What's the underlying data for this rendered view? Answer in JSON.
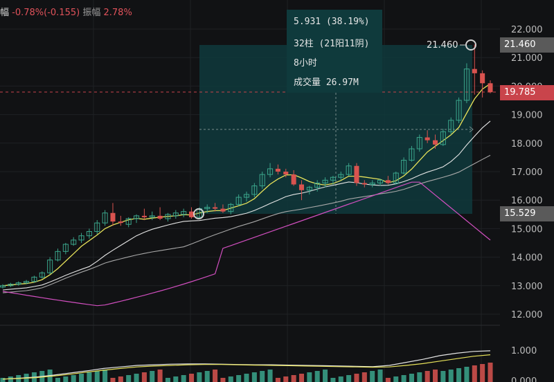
{
  "header": {
    "label_fragment": "幅",
    "change": "-0.78%(-0.155)",
    "amplitude_label": "振幅",
    "amplitude_value": "2.78%"
  },
  "info_box": {
    "change_line": "5.931 (38.19%)",
    "bars_line": "32柱 (21阳11阴)",
    "duration_line": "8小时",
    "volume_line": "成交量 26.97M"
  },
  "price_tags": {
    "high": "21.460",
    "current": "19.785",
    "low": "15.529"
  },
  "annotations": {
    "high_label": "21.460"
  },
  "colors": {
    "background": "#111214",
    "up": "#3ba68c",
    "down": "#d9534f",
    "ma_short": "#e8e35a",
    "ma_mid": "#e6e6e6",
    "ma_long": "#a9a9a9",
    "ma_purple": "#d24fc0",
    "measure_box": "#0f3a3c",
    "current_tag": "#c9444b",
    "high_tag": "#5a5a5a",
    "low_tag": "#5a5a5a"
  },
  "chart_data": [
    {
      "type": "candlestick",
      "y_ticks": [
        "22.000",
        "21.000",
        "20.000",
        "19.000",
        "18.000",
        "17.000",
        "16.000",
        "15.000",
        "14.000",
        "13.000",
        "12.000"
      ],
      "ylim": [
        11.5,
        22.3
      ],
      "candles": [
        [
          12.95,
          13.05,
          12.9,
          13.0
        ],
        [
          13.0,
          13.1,
          12.95,
          13.05
        ],
        [
          13.05,
          13.15,
          13.0,
          13.1
        ],
        [
          13.1,
          13.2,
          13.05,
          13.15
        ],
        [
          13.15,
          13.35,
          13.1,
          13.3
        ],
        [
          13.3,
          13.5,
          13.25,
          13.45
        ],
        [
          13.45,
          14.0,
          13.4,
          13.9
        ],
        [
          13.9,
          14.3,
          13.85,
          14.2
        ],
        [
          14.2,
          14.5,
          14.1,
          14.45
        ],
        [
          14.45,
          14.7,
          14.4,
          14.6
        ],
        [
          14.6,
          14.85,
          14.5,
          14.75
        ],
        [
          14.75,
          15.0,
          14.65,
          14.9
        ],
        [
          14.9,
          15.3,
          14.8,
          15.2
        ],
        [
          15.2,
          15.65,
          15.1,
          15.55
        ],
        [
          15.55,
          15.9,
          15.1,
          15.25
        ],
        [
          15.25,
          15.45,
          15.1,
          15.2
        ],
        [
          15.15,
          15.4,
          15.05,
          15.35
        ],
        [
          15.35,
          15.5,
          15.2,
          15.45
        ],
        [
          15.45,
          15.7,
          15.3,
          15.4
        ],
        [
          15.4,
          15.6,
          15.3,
          15.45
        ],
        [
          15.45,
          15.75,
          15.3,
          15.35
        ],
        [
          15.35,
          15.55,
          15.25,
          15.5
        ],
        [
          15.45,
          15.65,
          15.35,
          15.55
        ],
        [
          15.5,
          15.7,
          15.4,
          15.6
        ],
        [
          15.6,
          15.75,
          15.35,
          15.4
        ],
        [
          15.4,
          15.75,
          15.35,
          15.7
        ],
        [
          15.7,
          15.85,
          15.55,
          15.75
        ],
        [
          15.75,
          15.9,
          15.6,
          15.7
        ],
        [
          15.7,
          15.85,
          15.55,
          15.6
        ],
        [
          15.6,
          15.9,
          15.5,
          15.85
        ],
        [
          15.85,
          16.2,
          15.8,
          16.1
        ],
        [
          16.1,
          16.3,
          15.95,
          16.2
        ],
        [
          16.2,
          16.6,
          16.1,
          16.5
        ],
        [
          16.5,
          17.0,
          16.4,
          16.9
        ],
        [
          16.9,
          17.3,
          16.8,
          17.1
        ],
        [
          17.1,
          17.25,
          16.9,
          17.0
        ],
        [
          17.0,
          17.1,
          16.8,
          16.9
        ],
        [
          16.9,
          17.05,
          16.5,
          16.55
        ],
        [
          16.55,
          16.7,
          16.0,
          16.35
        ],
        [
          16.35,
          16.5,
          16.2,
          16.45
        ],
        [
          16.45,
          16.7,
          16.3,
          16.6
        ],
        [
          16.6,
          16.8,
          16.45,
          16.7
        ],
        [
          16.7,
          16.85,
          16.55,
          16.8
        ],
        [
          16.8,
          17.0,
          16.7,
          16.9
        ],
        [
          16.9,
          17.3,
          16.85,
          17.2
        ],
        [
          17.2,
          17.3,
          16.5,
          16.6
        ],
        [
          16.6,
          16.7,
          16.45,
          16.55
        ],
        [
          16.55,
          16.7,
          16.45,
          16.6
        ],
        [
          16.6,
          16.75,
          16.5,
          16.7
        ],
        [
          16.7,
          16.85,
          16.55,
          16.6
        ],
        [
          16.6,
          17.0,
          16.55,
          16.95
        ],
        [
          16.95,
          17.5,
          16.9,
          17.4
        ],
        [
          17.4,
          17.9,
          17.35,
          17.8
        ],
        [
          17.8,
          18.3,
          17.7,
          18.2
        ],
        [
          18.2,
          18.45,
          18.0,
          18.1
        ],
        [
          18.1,
          18.3,
          17.8,
          17.95
        ],
        [
          17.95,
          18.5,
          17.9,
          18.4
        ],
        [
          18.4,
          18.9,
          18.3,
          18.8
        ],
        [
          18.8,
          19.6,
          18.7,
          19.5
        ],
        [
          19.5,
          20.8,
          19.4,
          20.6
        ],
        [
          20.6,
          21.46,
          19.7,
          20.45
        ],
        [
          20.45,
          20.55,
          19.6,
          20.1
        ],
        [
          20.1,
          20.2,
          19.75,
          19.785
        ]
      ]
    },
    {
      "type": "line",
      "y_ticks": [
        "1.000",
        "0.000"
      ],
      "series": [
        {
          "values": [
            0.05,
            0.08,
            0.12,
            0.18,
            0.25,
            0.32,
            0.4,
            0.45,
            0.5,
            0.52,
            0.54,
            0.55,
            0.55,
            0.54,
            0.53,
            0.52,
            0.52,
            0.51,
            0.5,
            0.49,
            0.48,
            0.47,
            0.46,
            0.5,
            0.6,
            0.7,
            0.82,
            0.9,
            0.96,
            0.98
          ]
        },
        {
          "values": [
            0.05,
            0.07,
            0.1,
            0.15,
            0.21,
            0.28,
            0.34,
            0.4,
            0.45,
            0.48,
            0.5,
            0.52,
            0.53,
            0.53,
            0.52,
            0.51,
            0.5,
            0.49,
            0.48,
            0.47,
            0.46,
            0.45,
            0.44,
            0.45,
            0.5,
            0.56,
            0.64,
            0.72,
            0.8,
            0.85
          ]
        }
      ]
    }
  ]
}
